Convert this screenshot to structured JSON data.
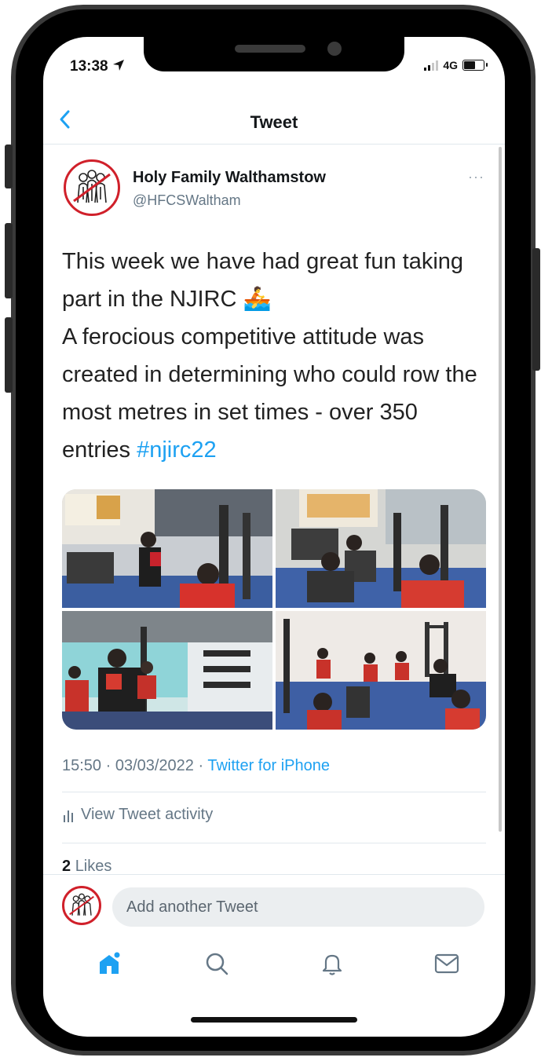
{
  "status_bar": {
    "time": "13:38",
    "network": "4G"
  },
  "nav": {
    "title": "Tweet"
  },
  "tweet": {
    "author_name": "Holy Family Walthamstow",
    "author_handle": "@HFCSWaltham",
    "more_label": "···",
    "text_lines": [
      "This week we have had great fun taking part in the NJIRC 🚣",
      "A ferocious competitive attitude was created in determining who could row the most metres in set times - over 350 entries "
    ],
    "hashtag": "#njirc22",
    "timestamp": "15:50 · 03/03/2022 · ",
    "source": "Twitter for iPhone",
    "activity_label": "View Tweet activity",
    "likes_count": "2",
    "likes_label": "Likes"
  },
  "reply": {
    "placeholder": "Add another Tweet"
  },
  "tabbar": {
    "items": [
      {
        "name": "home",
        "icon": "home-icon",
        "active": true
      },
      {
        "name": "search",
        "icon": "search-icon",
        "active": false
      },
      {
        "name": "notifications",
        "icon": "bell-icon",
        "active": false
      },
      {
        "name": "messages",
        "icon": "mail-icon",
        "active": false
      }
    ]
  },
  "colors": {
    "accent": "#1da1f2",
    "brand_red": "#d0202a",
    "muted": "#657786"
  }
}
